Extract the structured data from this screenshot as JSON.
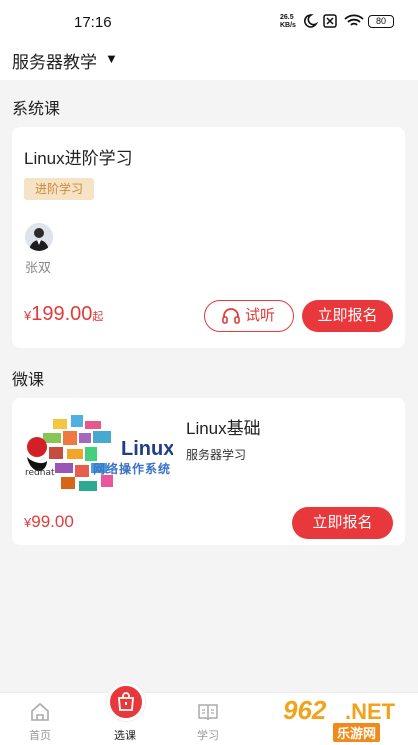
{
  "status_bar": {
    "time": "17:16",
    "net_speed_value": "26.5",
    "net_speed_unit": "KB/s",
    "battery": "80"
  },
  "header": {
    "title": "服务器教学",
    "caret": "▼"
  },
  "sections": {
    "system_course": "系统课",
    "micro_course": "微课"
  },
  "system_course_card": {
    "title": "Linux进阶学习",
    "tag": "进阶学习",
    "teacher": "张双",
    "price_symbol": "¥",
    "price": "199.00",
    "price_suffix": "起",
    "listen_label": "试听",
    "enroll_label": "立即报名"
  },
  "micro_course_card": {
    "thumb_title": "Linux",
    "thumb_subtitle": "网络操作系统",
    "thumb_brand": "redhat",
    "title": "Linux基础",
    "subtitle": "服务器学习",
    "price_symbol": "¥",
    "price": "99.00",
    "enroll_label": "立即报名"
  },
  "tabbar": {
    "home": "首页",
    "courses": "选课",
    "study": "学习"
  },
  "watermark": {
    "number": "962",
    "suffix": ".NET",
    "cn": "乐游网"
  },
  "colors": {
    "accent": "#e8383b",
    "tag_bg": "#f6e2c4",
    "tag_text": "#c98a3a"
  }
}
